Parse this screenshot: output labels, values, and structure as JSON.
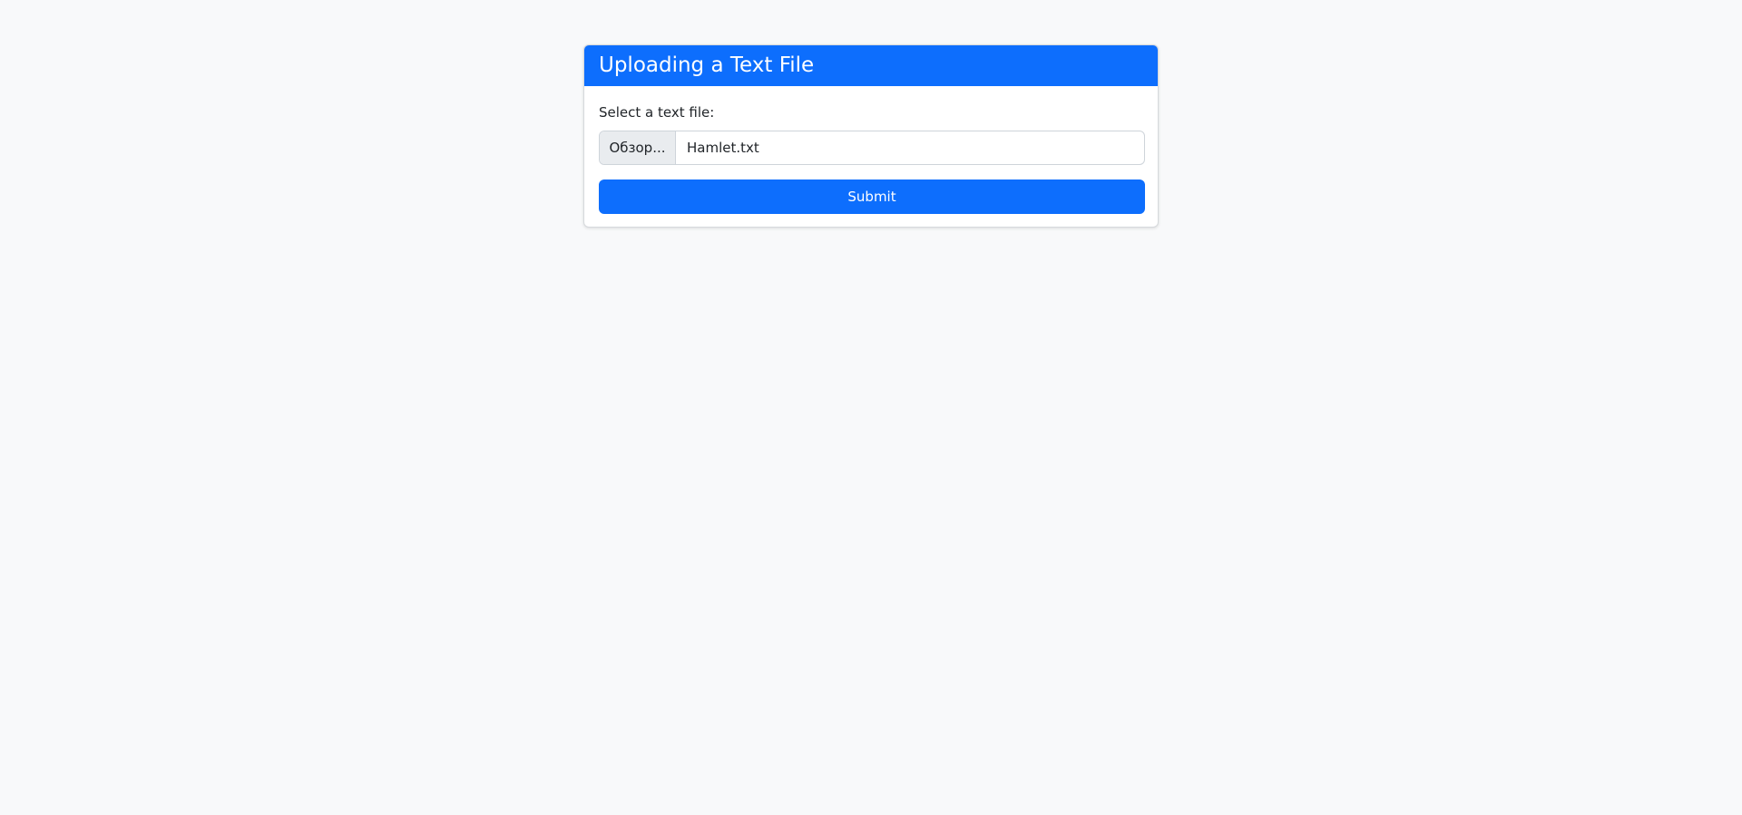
{
  "form": {
    "title": "Uploading a Text File",
    "label": "Select a text file:",
    "browse_label": "Обзор...",
    "file_name": "Hamlet.txt",
    "submit_label": "Submit"
  },
  "colors": {
    "primary": "#0d6efd",
    "background": "#f8f9fa",
    "card": "#ffffff"
  }
}
